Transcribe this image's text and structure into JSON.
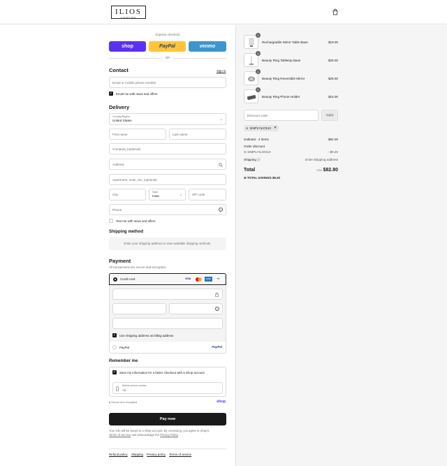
{
  "header": {
    "logo_text": "ILIOS",
    "logo_sub": "LIGHTING",
    "cart_icon": "shopping-bag-icon"
  },
  "express": {
    "title": "Express checkout",
    "shop": "shop",
    "paypal": "PayPal",
    "venmo": "venmo",
    "or": "OR",
    "colors": {
      "shop": "#5a31f4",
      "paypal": "#ffc439",
      "venmo": "#3d95ce"
    }
  },
  "contact": {
    "heading": "Contact",
    "sign_in": "Sign in",
    "email_placeholder": "Email or mobile phone number",
    "news_label": "Email me with news and offers",
    "news_checked": true
  },
  "delivery": {
    "heading": "Delivery",
    "country_label": "Country/Region",
    "country_value": "United States",
    "first_name": "First name",
    "last_name": "Last name",
    "company": "Company (optional)",
    "address": "Address",
    "apartment": "Apartment, suite, etc. (optional)",
    "city": "City",
    "state_label": "State",
    "state_value": "Iowa",
    "zip": "ZIP code",
    "phone": "Phone",
    "text_label": "Text me with news and offers",
    "text_checked": false
  },
  "shipping_method": {
    "heading": "Shipping method",
    "note": "Enter your shipping address to view available shipping methods."
  },
  "payment": {
    "heading": "Payment",
    "subtitle": "All transactions are secure and encrypted.",
    "credit_card": "Credit card",
    "card_brands": [
      "VISA",
      "MC",
      "AMEX",
      "+4"
    ],
    "billing_label": "Use shipping address as billing address",
    "billing_checked": true,
    "paypal_label": "PayPal",
    "paypal_logo": "PayPal"
  },
  "remember": {
    "heading": "Remember me",
    "save_label": "Save my information for a faster checkout with a Shop account",
    "save_checked": true,
    "mobile_label": "Mobile phone number",
    "mobile_value": "+1",
    "secure": "Secure and encrypted",
    "shop": "shop"
  },
  "pay_button": "Pay now",
  "legal": {
    "line1": "Your info will be saved to a Shop account. By continuing, you agree to Shop's",
    "tos": "Terms of Service",
    "and": " and acknowledge the ",
    "privacy": "Privacy Policy",
    "end": "."
  },
  "footer_links": [
    "Refund policy",
    "Shipping",
    "Privacy policy",
    "Terms of service"
  ],
  "cart": {
    "items": [
      {
        "name": "Rechargeable Mirror Table Base",
        "price": "$19.00",
        "qty": "1"
      },
      {
        "name": "Beauty Ring Tabletop Base",
        "price": "$29.00",
        "qty": "1"
      },
      {
        "name": "Beauty Ring Reversible Mirror",
        "price": "$29.00",
        "qty": "1"
      },
      {
        "name": "Beauty Ring Phone Holder",
        "price": "$15.00",
        "qty": "1"
      }
    ],
    "discount_placeholder": "Discount code",
    "apply": "Apply",
    "applied_code": "SIMPLYILIOS10",
    "subtotal_label": "Subtotal · 4 items",
    "subtotal_value": "$92.00",
    "order_discount_label": "Order discount",
    "discount_code": "SIMPLYILIOS10",
    "discount_value": "- $9.20",
    "shipping_label": "Shipping",
    "shipping_value": "Enter shipping address",
    "total_label": "Total",
    "currency": "USD",
    "total_value": "$82.80",
    "savings_label": "TOTAL SAVINGS",
    "savings_value": "$9.20"
  }
}
